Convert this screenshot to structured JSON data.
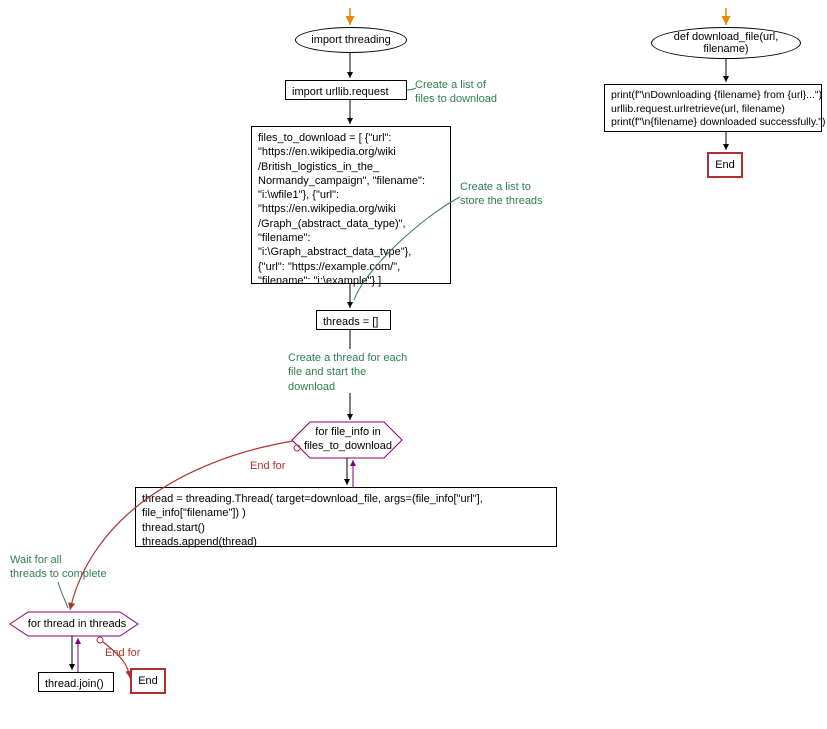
{
  "colors": {
    "comment": "#2f7f4f",
    "red": "#b03030",
    "purple": "#800080",
    "orange": "#e68a00"
  },
  "left": {
    "ellipse_start": "import threading",
    "box_urllib": "import urllib.request",
    "comment_files_list": "Create a list of\nfiles to download",
    "box_files": "files_to_download = [ {\"url\":\n\"https://en.wikipedia.org/wiki\n/British_logistics_in_the_\nNormandy_campaign\", \"filename\":\n\"i:\\wfile1\"}, {\"url\":\n\"https://en.wikipedia.org/wiki\n/Graph_(abstract_data_type)\",\n\"filename\":\n\"i:\\Graph_abstract_data_type\"},\n{\"url\": \"https://example.com/\",\n\"filename\": \"i:\\example\"} ]",
    "comment_store_threads": "Create a list to\nstore the threads",
    "box_threads_empty": "threads = []",
    "comment_thread_each": "Create a thread for each\nfile and start the\ndownload",
    "hex_for_files": "for file_info in\nfiles_to_download",
    "end_for_1": "End for",
    "box_thread_create": "thread = threading.Thread( target=download_file, args=(file_info[\"url\"],\nfile_info[\"filename\"]) )\nthread.start()\nthreads.append(thread)",
    "comment_wait_all": "Wait for all\nthreads to complete",
    "hex_for_threads": "for thread in threads",
    "end_for_2": "End for",
    "box_join": "thread.join()",
    "end_label": "End"
  },
  "right": {
    "ellipse_def": "def download_file(url,\nfilename)",
    "box_body": "print(f\"\\nDownloading {filename} from {url}...\")\nurllib.request.urlretrieve(url, filename)\nprint(f\"\\n{filename} downloaded successfully.\")",
    "end_label": "End"
  }
}
